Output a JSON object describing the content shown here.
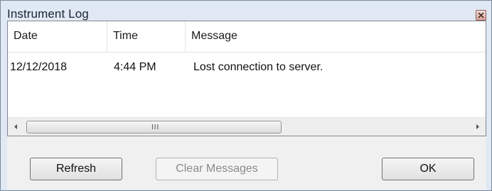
{
  "window": {
    "title": "Instrument Log"
  },
  "log_table": {
    "columns": [
      "Date",
      "Time",
      "Message"
    ],
    "rows": [
      {
        "date": "12/12/2018",
        "time": "4:44 PM",
        "message": "Lost connection to server."
      }
    ]
  },
  "scrollbar": {
    "grip": "III"
  },
  "buttons": {
    "refresh": "Refresh",
    "clear_messages": "Clear Messages",
    "ok": "OK"
  },
  "icons": {
    "close": "close-icon",
    "scroll_left": "arrow-left-icon",
    "scroll_right": "arrow-right-icon"
  },
  "colors": {
    "window_bg": "#dfe8f3",
    "panel_bg": "#f0f0f0",
    "close_button": "#d9a89d"
  }
}
